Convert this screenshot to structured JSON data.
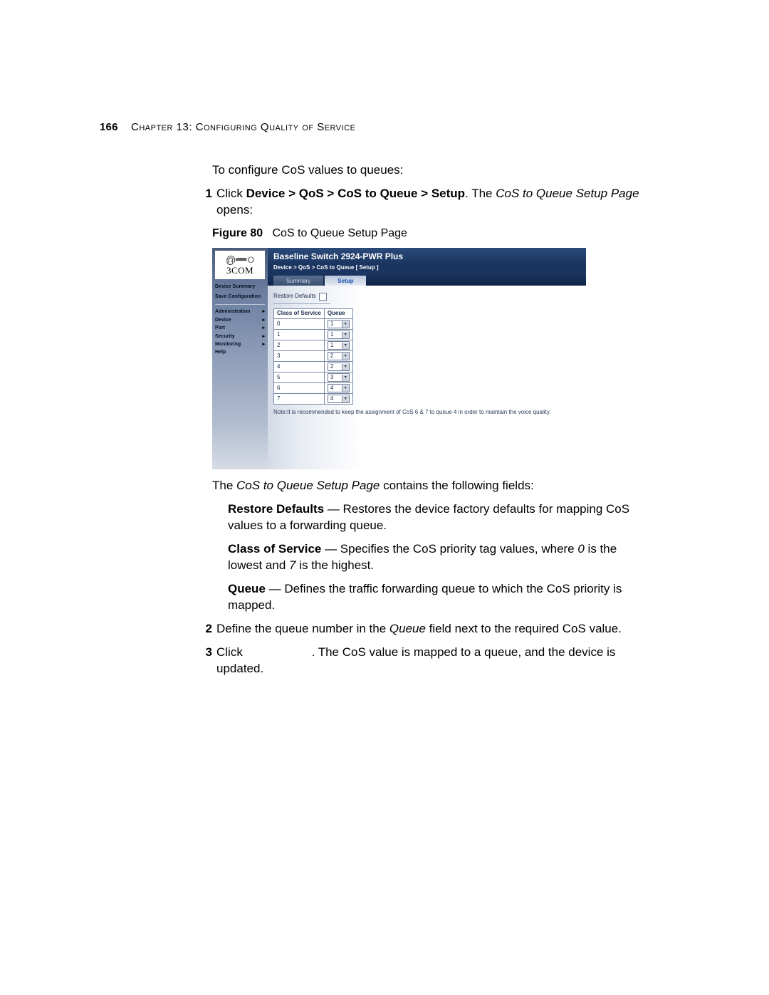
{
  "header": {
    "page_number": "166",
    "chapter_label": "Chapter 13: Configuring Quality of Service"
  },
  "intro": "To configure CoS values to queues:",
  "step1": {
    "num": "1",
    "prefix": "Click ",
    "bold_path": "Device > QoS > CoS to Queue > Setup",
    "after_path": ". The ",
    "ital": "CoS to Queue Setup Page",
    "suffix": " opens:"
  },
  "figure": {
    "label": "Figure 80",
    "caption": "CoS to Queue Setup Page"
  },
  "screenshot": {
    "brand": "3COM",
    "product_title": "Baseline Switch 2924-PWR Plus",
    "breadcrumb": "Device > QoS > CoS to Queue [ Setup ]",
    "tabs": {
      "summary": "Summary",
      "setup": "Setup"
    },
    "side_links": {
      "device_summary": "Device Summary",
      "save_config": "Save Configuration"
    },
    "side_items": {
      "administration": "Administration",
      "device": "Device",
      "port": "Port",
      "security": "Security",
      "monitoring": "Monitoring",
      "help": "Help"
    },
    "restore_label": "Restore Defaults",
    "table": {
      "h1": "Class of Service",
      "h2": "Queue",
      "rows": [
        {
          "cos": "0",
          "queue": "1"
        },
        {
          "cos": "1",
          "queue": "1"
        },
        {
          "cos": "2",
          "queue": "1"
        },
        {
          "cos": "3",
          "queue": "2"
        },
        {
          "cos": "4",
          "queue": "2"
        },
        {
          "cos": "5",
          "queue": "3"
        },
        {
          "cos": "6",
          "queue": "4"
        },
        {
          "cos": "7",
          "queue": "4"
        }
      ]
    },
    "note": "Note:It is recommended to keep the assignment of CoS 6 & 7 to queue 4 in order to maintain the voice quality."
  },
  "after_figure": {
    "lead_a": "The ",
    "lead_ital": "CoS to Queue Setup Page",
    "lead_b": " contains the following fields:",
    "b1_label": "Restore Defaults",
    "b1_text": " — Restores the device factory defaults for mapping CoS values to a forwarding queue.",
    "b2_label": "Class of Service",
    "b2_a": " — Specifies the CoS priority tag values, where ",
    "b2_i0": "0",
    "b2_b": " is the lowest and ",
    "b2_i7": "7",
    "b2_c": " is the highest.",
    "b3_label": "Queue",
    "b3_text": " — Defines the traffic forwarding queue to which the CoS priority is mapped."
  },
  "step2": {
    "num": "2",
    "a": "Define the queue number in the ",
    "ital": "Queue",
    "b": " field next to the required CoS value."
  },
  "step3": {
    "num": "3",
    "a": "Click ",
    "b": ". The CoS value is mapped to a queue, and the device is updated."
  }
}
